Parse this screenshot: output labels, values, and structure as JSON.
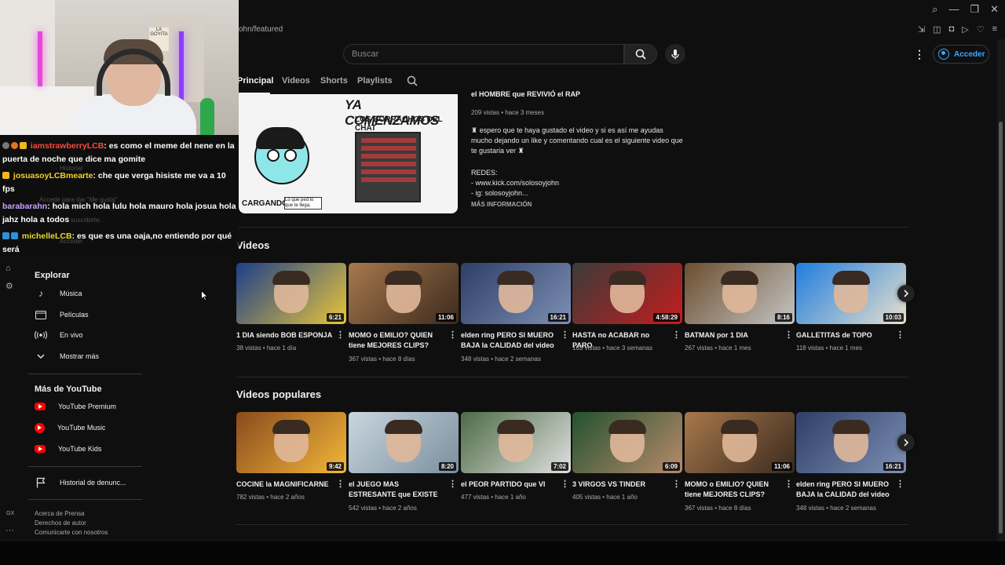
{
  "browser": {
    "url_fragment": "ohn/featured",
    "win_controls": [
      "⌕",
      "—",
      "❐",
      "✕"
    ],
    "actions": [
      "⇲",
      "◫",
      "◘",
      "▷",
      "♡",
      "≡"
    ]
  },
  "header": {
    "search_placeholder": "Buscar",
    "signin_label": "Acceder"
  },
  "tabs": [
    "Principal",
    "Videos",
    "Shorts",
    "Playlists"
  ],
  "featured": {
    "thumb_title": "YA COMENZAMOS",
    "thumb_subtitle": "LOS BORRACHOS DEL CHAT",
    "thumb_loading": "CARGANDO",
    "thumb_note": "Lo que ped lo que te llega.",
    "title": "el HOMBRE que REVIVIÓ el RAP",
    "meta": "209 vistas • hace 3 meses",
    "desc1": "♜ espero que te haya gustado el video y si es así me ayudas mucho dejando un like y comentando cual es el siguiente video que te gustaria ver ♜",
    "desc2": "REDES:",
    "desc3": "- www.kick.com/solosoyjohn",
    "desc4": "- ig: solosoyjohn...",
    "more": "MÁS INFORMACIÓN"
  },
  "sections": {
    "videos": "Videos",
    "popular": "Videos populares"
  },
  "videos": [
    {
      "title": "1 DIA siendo BOB ESPONJA",
      "meta1": "38 vistas • hace 1 día",
      "duration": "6:21",
      "colors": [
        "#1d3e8a",
        "#e8c53a"
      ]
    },
    {
      "title": "MOMO o EMILIO? QUIEN tiene MEJORES CLIPS?",
      "meta1": "367 vistas • hace 8 días",
      "duration": "11:06",
      "colors": [
        "#a8784c",
        "#3b2a1e"
      ]
    },
    {
      "title": "elden ring PERO SI MUERO BAJA la CALIDAD del video",
      "meta1": "348 vistas • hace 2 semanas",
      "duration": "16:21",
      "colors": [
        "#2d3f66",
        "#7e8fb5"
      ]
    },
    {
      "title": "HASTA no ACABAR no PARO",
      "meta1": "163 vistas • hace 3 semanas",
      "duration": "4:58:29",
      "colors": [
        "#3b3b3b",
        "#c41d1d"
      ]
    },
    {
      "title": "BATMAN por 1 DIA",
      "meta1": "267 vistas • hace 1 mes",
      "duration": "8:16",
      "colors": [
        "#6b4e2e",
        "#c4c4c4"
      ]
    },
    {
      "title": "GALLETITAS de TOPO",
      "meta1": "118 vistas • hace 1 mes",
      "duration": "10:03",
      "colors": [
        "#1f7de0",
        "#e8e1cc"
      ]
    }
  ],
  "popular": [
    {
      "title": "COCINE la MAGNIFICARNE",
      "meta1": "782 vistas • hace 2 años",
      "duration": "9:42",
      "colors": [
        "#8a4a1c",
        "#f2b73a"
      ]
    },
    {
      "title": "el JUEGO MAS ESTRESANTE que EXISTE",
      "meta1": "542 vistas • hace 2 años",
      "duration": "8:20",
      "colors": [
        "#c9d6df",
        "#7a8f9e"
      ]
    },
    {
      "title": "el PEOR PARTIDO que VI",
      "meta1": "477 vistas • hace 1 año",
      "duration": "7:02",
      "colors": [
        "#4d6b45",
        "#e0e0e0"
      ]
    },
    {
      "title": "3 VIRGOS VS TINDER",
      "meta1": "405 vistas • hace 1 año",
      "duration": "6:09",
      "colors": [
        "#23522f",
        "#b88a6c"
      ]
    },
    {
      "title": "MOMO o EMILIO? QUIEN tiene MEJORES CLIPS?",
      "meta1": "367 vistas • hace 8 días",
      "duration": "11:06",
      "colors": [
        "#a8784c",
        "#3b2a1e"
      ]
    },
    {
      "title": "elden ring PERO SI MUERO BAJA la CALIDAD del video",
      "meta1": "348 vistas • hace 2 semanas",
      "duration": "16:21",
      "colors": [
        "#2d3f66",
        "#7e8fb5"
      ]
    }
  ],
  "sidebar": {
    "explore_title": "Explorar",
    "explore": [
      {
        "label": "Música",
        "icon": "♪"
      },
      {
        "label": "Películas",
        "icon": "▤"
      },
      {
        "label": "En vivo",
        "icon": "((·))"
      },
      {
        "label": "Mostrar más",
        "icon": "⌄"
      }
    ],
    "more_title": "Más de YouTube",
    "more": [
      "YouTube Premium",
      "YouTube Music",
      "YouTube Kids"
    ],
    "report": "Historial de denunc...",
    "footer1": "Acerca de  Prensa",
    "footer2": "Derechos de autor",
    "footer3": "Comunicarte con nosotros"
  },
  "rail": {
    "gx": "GX",
    "dots": "···"
  },
  "chat": [
    {
      "user": "iamstrawberryLCB",
      "msg": ": es como el meme del nene en la puerta de noche que dice ma gomite"
    },
    {
      "user": "josuasoyLCBmearte",
      "msg": ": che que verga hisiste me va a 10 fps"
    },
    {
      "user": "barabarahn",
      "msg": ": hola mich hola lulu hola mauro hola josua hola jahz hola a todos"
    },
    {
      "user": "michelleLCB",
      "msg": ": es que es una oaja,no entiendo por qué será"
    }
  ],
  "ghost": {
    "historial": "Historial",
    "like": "Accede para dar \"Me gusta\"",
    "subscribe": "suscribirte.",
    "acceder": "Acceder"
  },
  "webcam_poster": "LA GOYITA"
}
